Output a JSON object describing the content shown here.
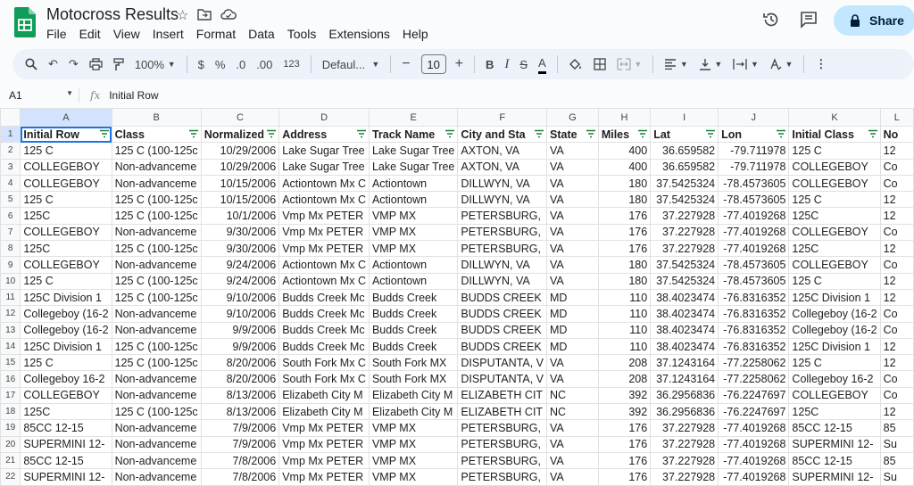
{
  "app": {
    "title": "Motocross Results",
    "share_label": "Share",
    "menu": [
      "File",
      "Edit",
      "View",
      "Insert",
      "Format",
      "Data",
      "Tools",
      "Extensions",
      "Help"
    ]
  },
  "toolbar": {
    "zoom": "100%",
    "currency": "$",
    "percent": "%",
    "dec_decrease": ".0",
    "dec_increase": ".00",
    "number_format": "123",
    "font": "Defaul...",
    "font_size": "10"
  },
  "formula_bar": {
    "cell_ref": "A1",
    "fx": "fx",
    "content": "Initial Row"
  },
  "sheet": {
    "column_letters": [
      "A",
      "B",
      "C",
      "D",
      "E",
      "F",
      "G",
      "H",
      "I",
      "J",
      "K",
      "L"
    ],
    "headers": [
      "Initial Row",
      "Class",
      "Normalized",
      "Address",
      "Track Name",
      "City and Sta",
      "State",
      "Miles",
      "Lat",
      "Lon",
      "Initial Class",
      "No"
    ],
    "rows": [
      [
        "125 C",
        "125 C (100-125c",
        "10/29/2006",
        "Lake Sugar Tree",
        "Lake Sugar Tree",
        "AXTON, VA",
        "VA",
        "400",
        "36.659582",
        "-79.711978",
        "125 C",
        "12"
      ],
      [
        "COLLEGEBOY",
        "Non-advanceme",
        "10/29/2006",
        "Lake Sugar Tree",
        "Lake Sugar Tree",
        "AXTON, VA",
        "VA",
        "400",
        "36.659582",
        "-79.711978",
        "COLLEGEBOY",
        "Co"
      ],
      [
        "COLLEGEBOY",
        "Non-advanceme",
        "10/15/2006",
        "Actiontown Mx C",
        "Actiontown",
        "DILLWYN, VA",
        "VA",
        "180",
        "37.5425324",
        "-78.4573605",
        "COLLEGEBOY",
        "Co"
      ],
      [
        "125 C",
        "125 C (100-125c",
        "10/15/2006",
        "Actiontown Mx C",
        "Actiontown",
        "DILLWYN, VA",
        "VA",
        "180",
        "37.5425324",
        "-78.4573605",
        "125 C",
        "12"
      ],
      [
        "125C",
        "125 C (100-125c",
        "10/1/2006",
        "Vmp Mx PETER",
        "VMP MX",
        "PETERSBURG,",
        "VA",
        "176",
        "37.227928",
        "-77.4019268",
        "125C",
        "12"
      ],
      [
        "COLLEGEBOY",
        "Non-advanceme",
        "9/30/2006",
        "Vmp Mx PETER",
        "VMP MX",
        "PETERSBURG,",
        "VA",
        "176",
        "37.227928",
        "-77.4019268",
        "COLLEGEBOY",
        "Co"
      ],
      [
        "125C",
        "125 C (100-125c",
        "9/30/2006",
        "Vmp Mx PETER",
        "VMP MX",
        "PETERSBURG,",
        "VA",
        "176",
        "37.227928",
        "-77.4019268",
        "125C",
        "12"
      ],
      [
        "COLLEGEBOY",
        "Non-advanceme",
        "9/24/2006",
        "Actiontown Mx C",
        "Actiontown",
        "DILLWYN, VA",
        "VA",
        "180",
        "37.5425324",
        "-78.4573605",
        "COLLEGEBOY",
        "Co"
      ],
      [
        "125 C",
        "125 C (100-125c",
        "9/24/2006",
        "Actiontown Mx C",
        "Actiontown",
        "DILLWYN, VA",
        "VA",
        "180",
        "37.5425324",
        "-78.4573605",
        "125 C",
        "12"
      ],
      [
        "125C Division 1",
        "125 C (100-125c",
        "9/10/2006",
        "Budds Creek Mc",
        "Budds Creek",
        "BUDDS CREEK",
        "MD",
        "110",
        "38.4023474",
        "-76.8316352",
        "125C Division 1",
        "12"
      ],
      [
        "Collegeboy (16-2",
        "Non-advanceme",
        "9/10/2006",
        "Budds Creek Mc",
        "Budds Creek",
        "BUDDS CREEK",
        "MD",
        "110",
        "38.4023474",
        "-76.8316352",
        "Collegeboy (16-2",
        "Co"
      ],
      [
        "Collegeboy (16-2",
        "Non-advanceme",
        "9/9/2006",
        "Budds Creek Mc",
        "Budds Creek",
        "BUDDS CREEK",
        "MD",
        "110",
        "38.4023474",
        "-76.8316352",
        "Collegeboy (16-2",
        "Co"
      ],
      [
        "125C Division 1",
        "125 C (100-125c",
        "9/9/2006",
        "Budds Creek Mc",
        "Budds Creek",
        "BUDDS CREEK",
        "MD",
        "110",
        "38.4023474",
        "-76.8316352",
        "125C Division 1",
        "12"
      ],
      [
        "125 C",
        "125 C (100-125c",
        "8/20/2006",
        "South Fork Mx C",
        "South Fork MX",
        "DISPUTANTA, V",
        "VA",
        "208",
        "37.1243164",
        "-77.2258062",
        "125 C",
        "12"
      ],
      [
        "Collegeboy 16-2",
        "Non-advanceme",
        "8/20/2006",
        "South Fork Mx C",
        "South Fork MX",
        "DISPUTANTA, V",
        "VA",
        "208",
        "37.1243164",
        "-77.2258062",
        "Collegeboy 16-2",
        "Co"
      ],
      [
        "COLLEGEBOY",
        "Non-advanceme",
        "8/13/2006",
        "Elizabeth City M",
        "Elizabeth City M",
        "ELIZABETH CIT",
        "NC",
        "392",
        "36.2956836",
        "-76.2247697",
        "COLLEGEBOY",
        "Co"
      ],
      [
        "125C",
        "125 C (100-125c",
        "8/13/2006",
        "Elizabeth City M",
        "Elizabeth City M",
        "ELIZABETH CIT",
        "NC",
        "392",
        "36.2956836",
        "-76.2247697",
        "125C",
        "12"
      ],
      [
        "85CC 12-15",
        "Non-advanceme",
        "7/9/2006",
        "Vmp Mx PETER",
        "VMP MX",
        "PETERSBURG,",
        "VA",
        "176",
        "37.227928",
        "-77.4019268",
        "85CC 12-15",
        "85"
      ],
      [
        "SUPERMINI 12-",
        "Non-advanceme",
        "7/9/2006",
        "Vmp Mx PETER",
        "VMP MX",
        "PETERSBURG,",
        "VA",
        "176",
        "37.227928",
        "-77.4019268",
        "SUPERMINI 12-",
        "Su"
      ],
      [
        "85CC 12-15",
        "Non-advanceme",
        "7/8/2006",
        "Vmp Mx PETER",
        "VMP MX",
        "PETERSBURG,",
        "VA",
        "176",
        "37.227928",
        "-77.4019268",
        "85CC 12-15",
        "85"
      ],
      [
        "SUPERMINI 12-",
        "Non-advanceme",
        "7/8/2006",
        "Vmp Mx PETER",
        "VMP MX",
        "PETERSBURG,",
        "VA",
        "176",
        "37.227928",
        "-77.4019268",
        "SUPERMINI 12-",
        "Su"
      ]
    ]
  },
  "colors": {
    "share_bg": "#c2e7ff",
    "toolbar_bg": "#edf2fa",
    "selection": "#1a73e8",
    "header_selected": "#d3e3fd",
    "sheets_green": "#0f9d58"
  }
}
